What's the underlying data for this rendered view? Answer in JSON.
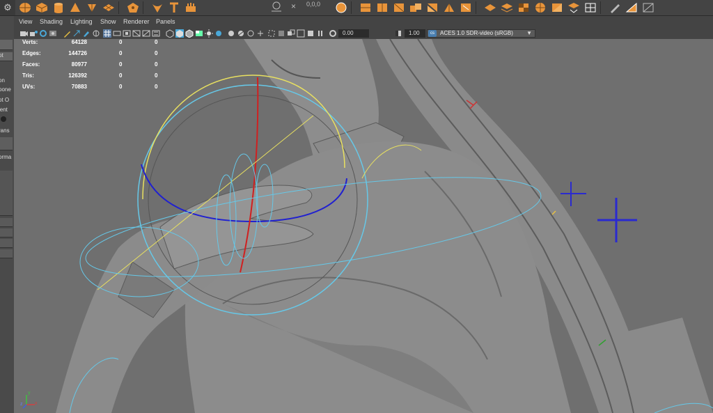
{
  "shelf": {
    "coord_display": "0,0,0"
  },
  "left_panel": {
    "fragments": [
      "ot",
      "on",
      "pone",
      "ot O",
      "ient",
      "rans",
      "orma"
    ]
  },
  "menu": [
    "View",
    "Shading",
    "Lighting",
    "Show",
    "Renderer",
    "Panels"
  ],
  "toolbar": {
    "exposure": "0.00",
    "gamma": "1.00",
    "color_space": "ACES 1.0 SDR-video (sRGB)"
  },
  "hud": {
    "rows": [
      {
        "label": "Verts:",
        "value": "64128",
        "c2": "0",
        "c3": "0"
      },
      {
        "label": "Edges:",
        "value": "144726",
        "c2": "0",
        "c3": "0"
      },
      {
        "label": "Faces:",
        "value": "80977",
        "c2": "0",
        "c3": "0"
      },
      {
        "label": "Tris:",
        "value": "126392",
        "c2": "0",
        "c3": "0"
      },
      {
        "label": "UVs:",
        "value": "70883",
        "c2": "0",
        "c3": "0"
      }
    ]
  },
  "axis": {
    "x": "x",
    "y": "y",
    "z": "z"
  },
  "colors": {
    "viewport_bg": "#6f6f6f",
    "ui_bg": "#444444",
    "shelf_icon": "#e8943a",
    "manip_outer": "#66c8e8",
    "manip_yellow": "#e8e060",
    "manip_blue": "#2020d0",
    "manip_red": "#d02020",
    "locator_blue": "#2a2ad0"
  }
}
